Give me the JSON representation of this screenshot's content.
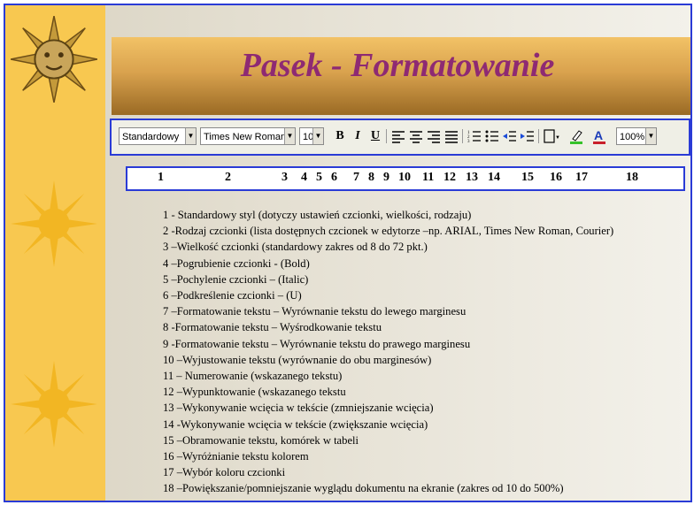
{
  "title": "Pasek - Formatowanie",
  "toolbar": {
    "style_combo": "Standardowy",
    "font_combo": "Times New Roman",
    "size_combo": "10",
    "bold": "B",
    "italic": "I",
    "underline": "U",
    "zoom_combo": "100%"
  },
  "numbers": [
    "1",
    "2",
    "3",
    "4",
    "5",
    "6",
    "7",
    "8",
    "9",
    "10",
    "11",
    "12",
    "13",
    "14",
    "15",
    "16",
    "17",
    "18"
  ],
  "list": [
    "1 - Standardowy styl (dotyczy ustawień czcionki, wielkości, rodzaju)",
    "2 -Rodzaj czcionki (lista dostępnych czcionek w edytorze –np. ARIAL, Times New Roman, Courier)",
    "3 –Wielkość czcionki (standardowy zakres od 8 do 72 pkt.)",
    "4 –Pogrubienie czcionki - (Bold)",
    "5 –Pochylenie czcionki – (Italic)",
    "6 –Podkreślenie czcionki – (U)",
    "7 –Formatowanie tekstu – Wyrównanie tekstu do lewego marginesu",
    "8 -Formatowanie tekstu – Wyśrodkowanie tekstu",
    "9 -Formatowanie tekstu – Wyrównanie tekstu do prawego marginesu",
    "10 –Wyjustowanie tekstu (wyrównanie do obu marginesów)",
    "11 – Numerowanie (wskazanego tekstu)",
    "12 –Wypunktowanie (wskazanego tekstu",
    "13 –Wykonywanie wcięcia w tekście (zmniejszanie wcięcia)",
    "14 -Wykonywanie wcięcia w tekście (zwiększanie wcięcia)",
    "15 –Obramowanie tekstu, komórek w tabeli",
    "16 –Wyróżnianie tekstu kolorem",
    "17 –Wybór koloru czcionki",
    "18 –Powiększanie/pomniejszanie wyglądu dokumentu na ekranie (zakres od 10 do 500%)"
  ],
  "icons": [
    "sun-face-icon",
    "sun-icon",
    "align-left-icon",
    "align-center-icon",
    "align-right-icon",
    "justify-icon",
    "numbering-icon",
    "bullets-icon",
    "decrease-indent-icon",
    "increase-indent-icon",
    "border-icon",
    "highlight-icon",
    "font-color-icon"
  ],
  "colors": {
    "border": "#2a3bd6",
    "title": "#8e2a73",
    "sun": "#f8c850",
    "highlight": "#35c32a",
    "font_color": "#c8202a"
  }
}
